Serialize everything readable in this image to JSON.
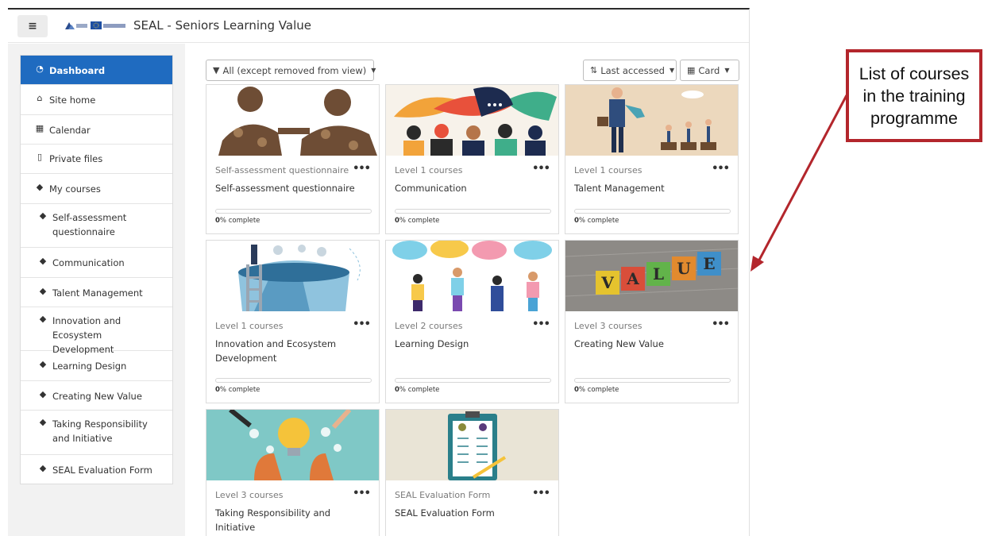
{
  "header": {
    "menu_icon": "hamburger-icon",
    "site_title": "SEAL - Seniors Learning Value"
  },
  "sidebar": {
    "items": [
      {
        "label": "Dashboard",
        "icon": "dashboard-icon",
        "active": true
      },
      {
        "label": "Site home",
        "icon": "home-icon"
      },
      {
        "label": "Calendar",
        "icon": "calendar-icon"
      },
      {
        "label": "Private files",
        "icon": "file-icon"
      },
      {
        "label": "My courses",
        "icon": "graduation-cap-icon"
      },
      {
        "label": "Self-assessment questionnaire",
        "icon": "graduation-cap-icon"
      },
      {
        "label": "Communication",
        "icon": "graduation-cap-icon"
      },
      {
        "label": "Talent Management",
        "icon": "graduation-cap-icon"
      },
      {
        "label": "Innovation and Ecosystem Development",
        "icon": "graduation-cap-icon"
      },
      {
        "label": "Learning Design",
        "icon": "graduation-cap-icon"
      },
      {
        "label": "Creating New Value",
        "icon": "graduation-cap-icon"
      },
      {
        "label": "Taking Responsibility and Initiative",
        "icon": "graduation-cap-icon"
      },
      {
        "label": "SEAL Evaluation Form",
        "icon": "graduation-cap-icon"
      }
    ]
  },
  "toolbar": {
    "filter_label": "All (except removed from view)",
    "sort_label": "Last accessed",
    "view_label": "Card"
  },
  "courses": [
    {
      "category": "Self-assessment questionnaire",
      "name": "Self-assessment questionnaire",
      "progress_pct": 0,
      "progress_value": "0",
      "progress_suffix": "% complete",
      "menu": "•••"
    },
    {
      "category": "Level 1 courses",
      "name": "Communication",
      "progress_pct": 0,
      "progress_value": "0",
      "progress_suffix": "% complete",
      "menu": "•••"
    },
    {
      "category": "Level 1 courses",
      "name": "Talent Management",
      "progress_pct": 0,
      "progress_value": "0",
      "progress_suffix": "% complete",
      "menu": "•••"
    },
    {
      "category": "Level 1 courses",
      "name": "Innovation and Ecosystem Development",
      "progress_pct": 0,
      "progress_value": "0",
      "progress_suffix": "% complete",
      "menu": "•••"
    },
    {
      "category": "Level 2 courses",
      "name": "Learning Design",
      "progress_pct": 0,
      "progress_value": "0",
      "progress_suffix": "% complete",
      "menu": "•••"
    },
    {
      "category": "Level 3 courses",
      "name": "Creating New Value",
      "progress_pct": 0,
      "progress_value": "0",
      "progress_suffix": "% complete",
      "menu": "•••",
      "image_letters": [
        "V",
        "A",
        "L",
        "U",
        "E"
      ]
    },
    {
      "category": "Level 3 courses",
      "name": "Taking Responsibility and Initiative",
      "menu": "•••"
    },
    {
      "category": "SEAL Evaluation Form",
      "name": "SEAL Evaluation Form",
      "menu": "•••"
    }
  ],
  "callout": {
    "text": "List of courses in the training programme"
  },
  "colors": {
    "accent": "#1f6bc0",
    "callout_border": "#b3262c"
  }
}
